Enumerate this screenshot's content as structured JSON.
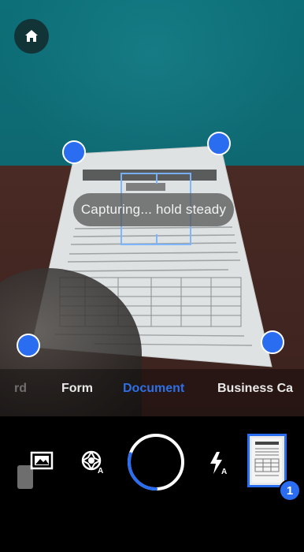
{
  "overlay": {
    "status_text": "Capturing... hold steady"
  },
  "modes": {
    "items": [
      {
        "label": "rd",
        "state": "dim"
      },
      {
        "label": "Form",
        "state": "normal"
      },
      {
        "label": "Document",
        "state": "active"
      },
      {
        "label": "Business Ca",
        "state": "normal"
      }
    ]
  },
  "controls": {
    "capture_progress": 0.3,
    "captured_count": "1"
  },
  "icons": {
    "home": "home-icon",
    "gallery": "gallery-icon",
    "auto_capture": "auto-capture-icon",
    "flash": "flash-auto-icon"
  },
  "colors": {
    "accent": "#2a6df0",
    "active_mode": "#2f6fe4",
    "toast_bg": "#5a5a5a",
    "controls_bg": "#000000"
  }
}
